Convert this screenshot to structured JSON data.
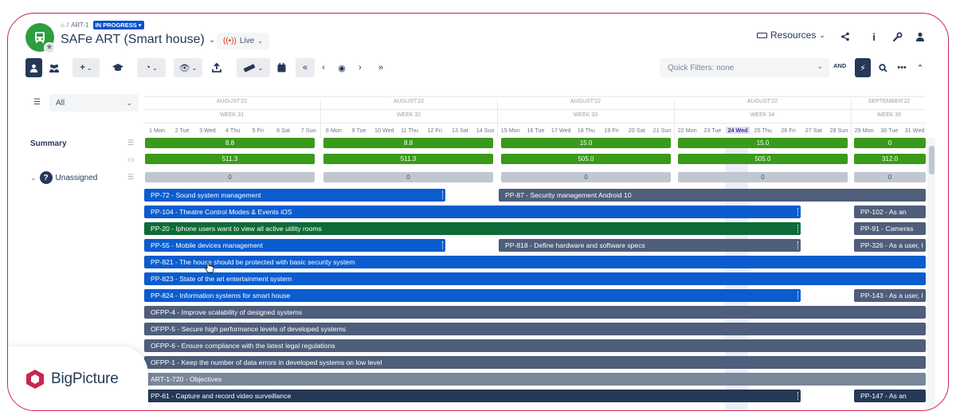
{
  "header": {
    "breadcrumb": "ART-1",
    "status": "IN PROGRESS",
    "title": "SAFe ART (Smart house)",
    "live_label": "Live",
    "resources_label": "Resources"
  },
  "toolbar": {
    "quick_filters_placeholder": "Quick Filters: none",
    "and_label": "AND"
  },
  "left_panel": {
    "filter_value": "All",
    "summary_label": "Summary",
    "unassigned_label": "Unassigned",
    "unassigned_avatar": "?"
  },
  "timeline": {
    "months": [
      "AUGUST'22",
      "AUGUST'22",
      "AUGUST'22",
      "AUGUST'22",
      "SEPTEMBER'22"
    ],
    "weeks": [
      "WEEK 31",
      "WEEK 32",
      "WEEK 33",
      "WEEK 34",
      "WEEK 35"
    ],
    "days": [
      "1 Mon",
      "2 Tue",
      "3 Wed",
      "4 Thu",
      "5 Fri",
      "6 Sat",
      "7 Sun",
      "8 Mon",
      "9 Tue",
      "10 Wed",
      "11 Thu",
      "12 Fri",
      "13 Sat",
      "14 Sun",
      "15 Mon",
      "16 Tue",
      "17 Wed",
      "18 Thu",
      "19 Fri",
      "20 Sat",
      "21 Sun",
      "22 Mon",
      "23 Tue",
      "24 Wed",
      "25 Thu",
      "26 Fri",
      "27 Sat",
      "28 Sun",
      "29 Mon",
      "30 Tue",
      "31 Wed"
    ],
    "highlighted_day": "24 Wed"
  },
  "summary": {
    "row1": [
      "8.8",
      "8.8",
      "15.0",
      "15.0",
      "0"
    ],
    "row2": [
      "511.3",
      "511.3",
      "505.0",
      "505.0",
      "312.0"
    ],
    "unassigned_row": [
      "0",
      "0",
      "0",
      "0",
      "0"
    ]
  },
  "tasks": {
    "t1": "PP-72 - Sound system management",
    "t2": "PP-87 - Security management Android 10",
    "t3": "PP-104 - Theatre Control Modes & Events iOS",
    "t4": "PP-102 - As an",
    "t5": "PP-20 - Iphone users want to view all active utility rooms",
    "t6": "PP-91 - Cameras",
    "t7": "PP-55 - Mobile devices management",
    "t8": "PP-818 - Define hardware and software specs",
    "t9": "PP-326 - As a user, I",
    "t10": "PP-821 - The house should be protected with basic security system",
    "t11": "PP-823 - State of the art entertainment system",
    "t12": "PP-824 - Information systems for smart house",
    "t13": "PP-143 - As a user, I",
    "t14": "OFPP-4 - Improve scalability of designed systems",
    "t15": "OFPP-5 - Secure high performance levels of developed systems",
    "t16": "OFPP-6 - Ensure compliance with the latest legal regulations",
    "t17": "OFPP-1 - Keep the number of data errors in developed systems on low level",
    "t18": "ART-1-720 - Objectives",
    "t19": "PP-61 - Capture and record video surveillance",
    "t20": "PP-147 - As an"
  },
  "brand": {
    "name": "BigPicture",
    "accent": "#c9264f"
  },
  "colors": {
    "blue_task": "#0b5ccf",
    "slate_task": "#4e5e7b",
    "green_task": "#0d6b37",
    "summary_green": "#3a9a19"
  }
}
